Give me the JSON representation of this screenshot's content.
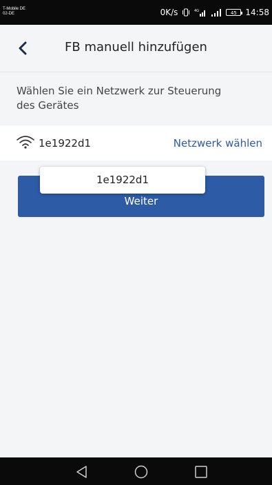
{
  "status_bar": {
    "carrier_line1": "T-Mobile DE",
    "carrier_line2": "02-DE",
    "net_speed": "0K/s",
    "battery_level": "45",
    "time": "14:58",
    "network_type": "4G"
  },
  "header": {
    "title": "FB manuell hinzufügen",
    "back_icon": "chevron-left-icon"
  },
  "instruction": {
    "text": "Wählen Sie ein Netzwerk zur Steuerung des Gerätes"
  },
  "network": {
    "icon": "wifi-icon",
    "name": "1e1922d1",
    "choose_label": "Netzwerk wählen"
  },
  "continue_button": {
    "label": "Weiter"
  },
  "tooltip": {
    "text": "1e1922d1"
  },
  "nav": {
    "back_icon": "nav-back-icon",
    "home_icon": "nav-home-icon",
    "recents_icon": "nav-recents-icon"
  },
  "colors": {
    "accent": "#2d5ba6",
    "background": "#f4f5f6",
    "status_bar": "#0a0a0a"
  }
}
